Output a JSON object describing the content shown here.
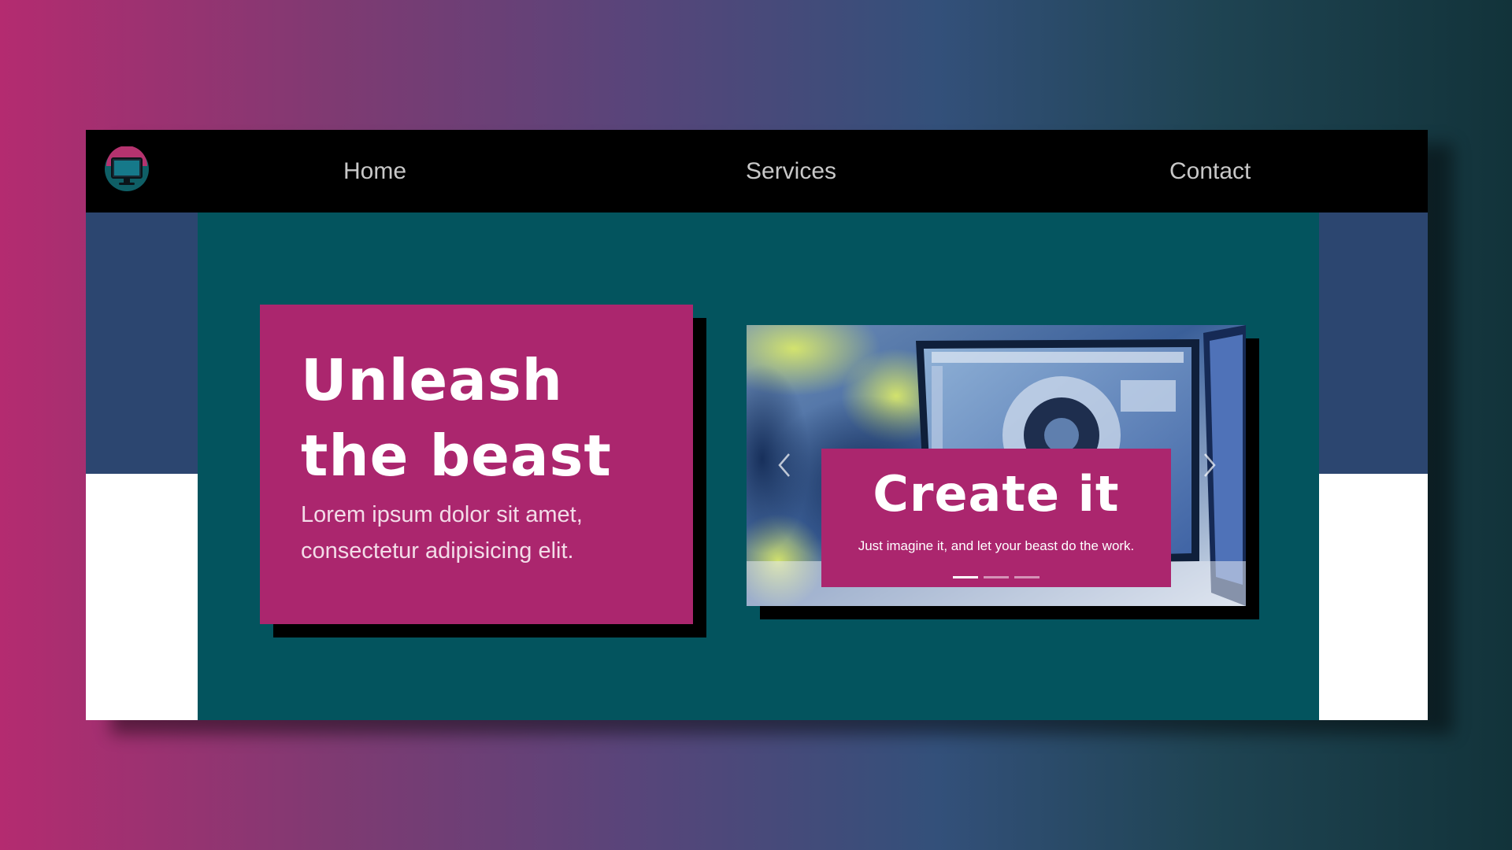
{
  "nav": {
    "logo_icon": "monitor-icon",
    "links": [
      {
        "label": "Home"
      },
      {
        "label": "Services"
      },
      {
        "label": "Contact"
      }
    ]
  },
  "hero": {
    "headline": "Unleash the beast",
    "lead": "Lorem ipsum dolor sit amet, consectetur adipisicing elit."
  },
  "carousel": {
    "slide_title": "Create it",
    "slide_text": "Just imagine it, and let your beast do the work.",
    "slide_count": 3,
    "active_slide": 1,
    "prev_icon": "chevron-left-icon",
    "next_icon": "chevron-right-icon"
  },
  "colors": {
    "navbar": "#000000",
    "hero_background": "#03545e",
    "accent_magenta": "#ab266e",
    "side_panel_top": "#2c4670",
    "side_panel_bottom": "#ffffff"
  }
}
